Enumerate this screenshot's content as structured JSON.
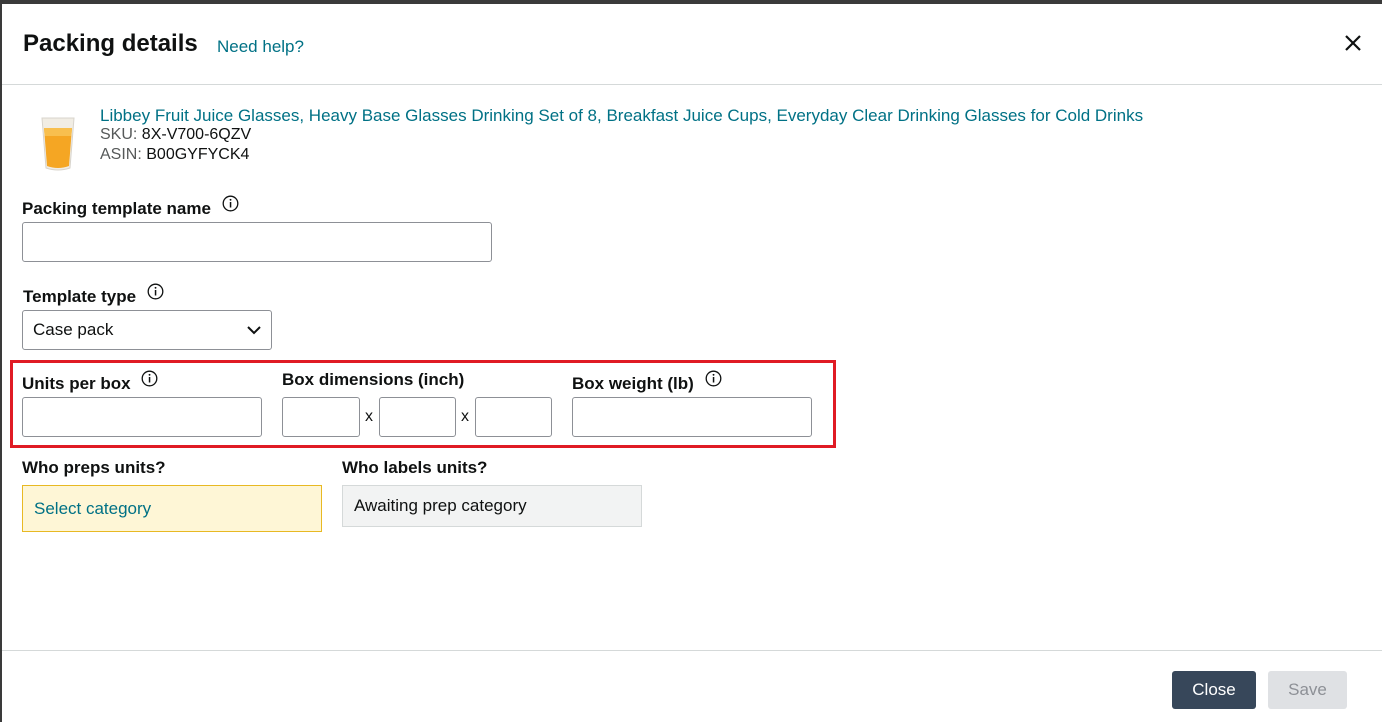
{
  "dialog": {
    "title": "Packing details",
    "help_link": "Need help?"
  },
  "product": {
    "title": "Libbey Fruit Juice Glasses, Heavy Base Glasses Drinking Set of 8, Breakfast Juice Cups, Everyday Clear Drinking Glasses for Cold Drinks",
    "sku_label": "SKU:",
    "sku": "8X-V700-6QZV",
    "asin_label": "ASIN:",
    "asin": "B00GYFYCK4"
  },
  "form": {
    "template_name_label": "Packing template name",
    "template_name_value": "",
    "template_type_label": "Template type",
    "template_type_value": "Case pack",
    "units_per_box_label": "Units per box",
    "units_per_box_value": "",
    "box_dimensions_label": "Box dimensions (inch)",
    "dim_separator": "x",
    "box_weight_label": "Box weight (lb)",
    "box_weight_value": "",
    "who_preps_label": "Who preps units?",
    "who_preps_value": "Select category",
    "who_labels_label": "Who labels units?",
    "who_labels_value": "Awaiting prep category"
  },
  "footer": {
    "close_label": "Close",
    "save_label": "Save"
  },
  "colors": {
    "link": "#007185",
    "primary_button": "#37475a",
    "highlight": "#e01b24",
    "prep_bg": "#fef6d6"
  }
}
